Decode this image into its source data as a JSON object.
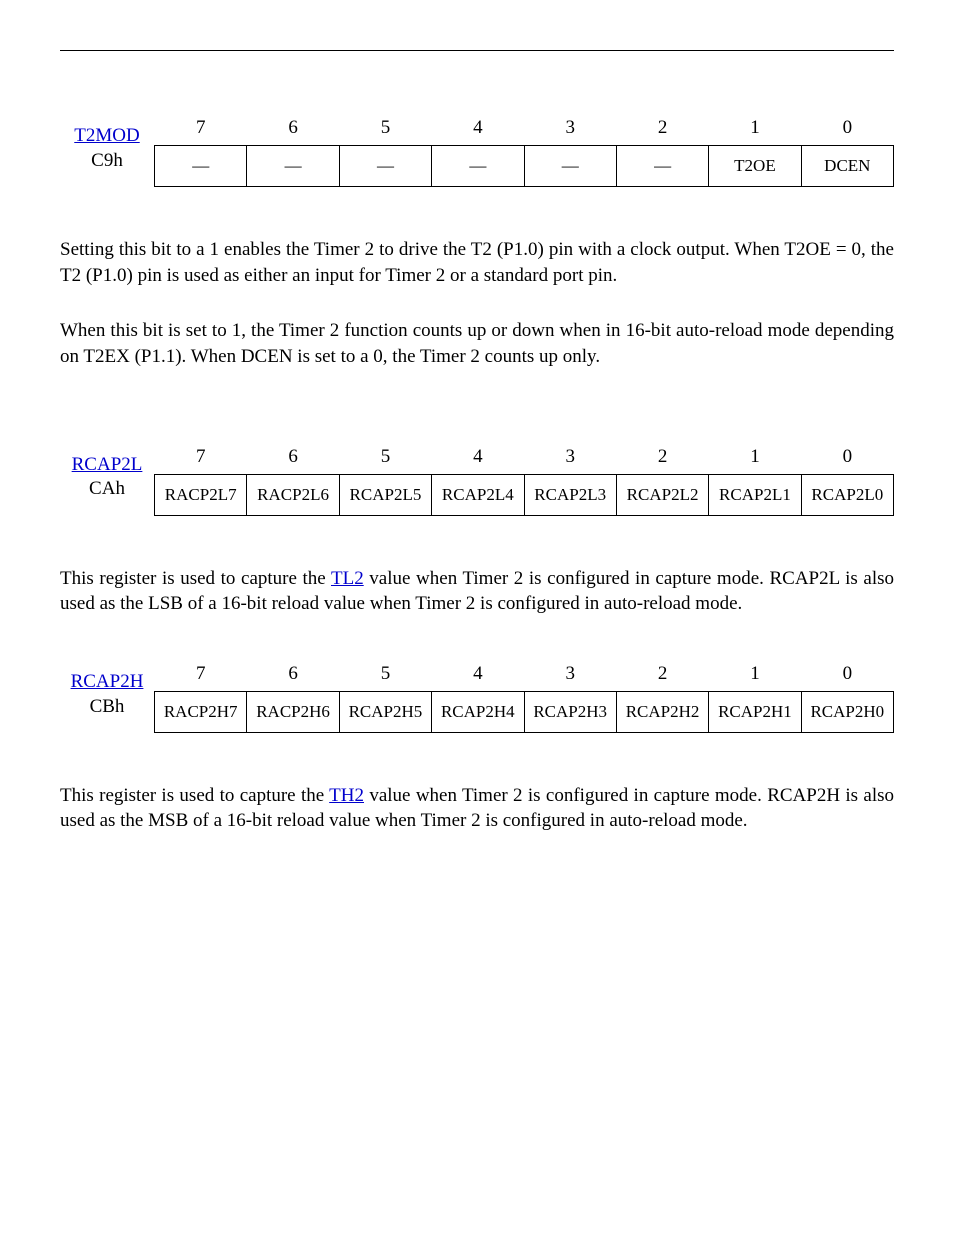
{
  "bit_numbers": [
    "7",
    "6",
    "5",
    "4",
    "3",
    "2",
    "1",
    "0"
  ],
  "registers": [
    {
      "name": "T2MOD",
      "addr": "C9h",
      "bits": [
        "—",
        "—",
        "—",
        "—",
        "—",
        "—",
        "T2OE",
        "DCEN"
      ]
    },
    {
      "name": "RCAP2L",
      "addr": "CAh",
      "bits": [
        "RACP2L7",
        "RACP2L6",
        "RCAP2L5",
        "RCAP2L4",
        "RCAP2L3",
        "RCAP2L2",
        "RCAP2L1",
        "RCAP2L0"
      ]
    },
    {
      "name": "RCAP2H",
      "addr": "CBh",
      "bits": [
        "RACP2H7",
        "RACP2H6",
        "RCAP2H5",
        "RCAP2H4",
        "RCAP2H3",
        "RCAP2H2",
        "RCAP2H1",
        "RCAP2H0"
      ]
    }
  ],
  "desc_t2oe": "Setting this bit to a 1 enables the Timer 2 to drive the T2 (P1.0) pin with a clock output. When T2OE = 0, the T2 (P1.0) pin is used as either an input for Timer 2 or a standard port pin.",
  "desc_dcen": "When this bit is set to 1, the Timer 2 function counts up or down when in 16-bit auto-reload mode depending on T2EX (P1.1). When DCEN is set to a 0, the Timer 2 counts up only.",
  "desc_rcap2l_pre": "This register is used to capture the ",
  "desc_rcap2l_link": "TL2",
  "desc_rcap2l_post": " value when Timer 2 is configured in capture mode. RCAP2L is also used as the LSB of a 16-bit reload value when Timer 2 is configured in auto-reload mode.",
  "desc_rcap2h_pre": "This register is used to capture the ",
  "desc_rcap2h_link": "TH2",
  "desc_rcap2h_post": " value when Timer 2 is configured in capture mode. RCAP2H is also used as the MSB of a 16-bit reload value when Timer 2 is configured in auto-reload mode."
}
